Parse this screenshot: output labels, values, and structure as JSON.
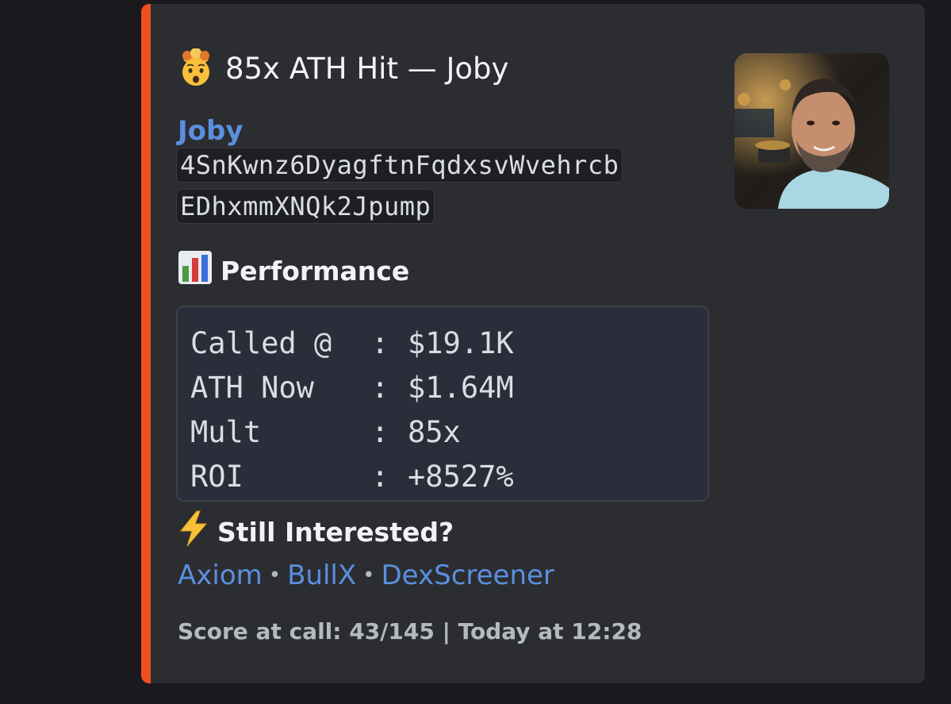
{
  "embed": {
    "accent_color": "#f04f1f",
    "title_icon": "exploding-head-icon",
    "title": "85x ATH Hit — Joby",
    "author": "Joby",
    "contract_line_1": "4SnKwnz6DyagftnFqdxsvWvehrcb",
    "contract_line_2": "EDhxmmXNQk2Jpump",
    "thumbnail_icon": "profile-photo-thumbnail",
    "performance": {
      "icon": "bar-chart-icon",
      "title": "Performance",
      "rows": [
        {
          "key": "Called @",
          "sep": ":",
          "value": "$19.1K"
        },
        {
          "key": "ATH Now",
          "sep": ":",
          "value": "$1.64M"
        },
        {
          "key": "Mult",
          "sep": ":",
          "value": "85x"
        },
        {
          "key": "ROI",
          "sep": ":",
          "value": "+8527%"
        }
      ]
    },
    "interest": {
      "icon": "lightning-icon",
      "title": "Still Interested?"
    },
    "links": {
      "items": [
        "Axiom",
        "BullX",
        "DexScreener"
      ],
      "separator": "•"
    },
    "footer": "Score at call: 43/145 | Today at 12:28"
  }
}
